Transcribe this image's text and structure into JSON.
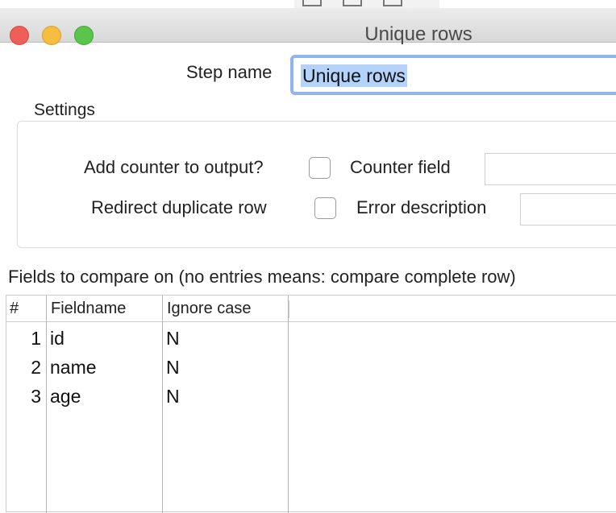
{
  "window": {
    "title": "Unique rows"
  },
  "step": {
    "label": "Step name",
    "value": "Unique rows"
  },
  "settings": {
    "title": "Settings",
    "add_counter_label": "Add counter to output?",
    "counter_field_label": "Counter field",
    "counter_field_value": "",
    "redirect_label": "Redirect duplicate row",
    "error_description_label": "Error description",
    "error_description_value": ""
  },
  "fields": {
    "heading": "Fields to compare on (no entries means: compare complete row)",
    "columns": [
      "#",
      "Fieldname",
      "Ignore case"
    ],
    "rows": [
      {
        "num": "1",
        "field": "id",
        "ignore": "N"
      },
      {
        "num": "2",
        "field": "name",
        "ignore": "N"
      },
      {
        "num": "3",
        "field": "age",
        "ignore": "N"
      }
    ]
  },
  "colors": {
    "close": "#ee5f57",
    "minimize": "#f5be41",
    "maximize": "#5bc44b",
    "focus_ring": "#8fb4ee",
    "selection": "#b3d3fb"
  }
}
